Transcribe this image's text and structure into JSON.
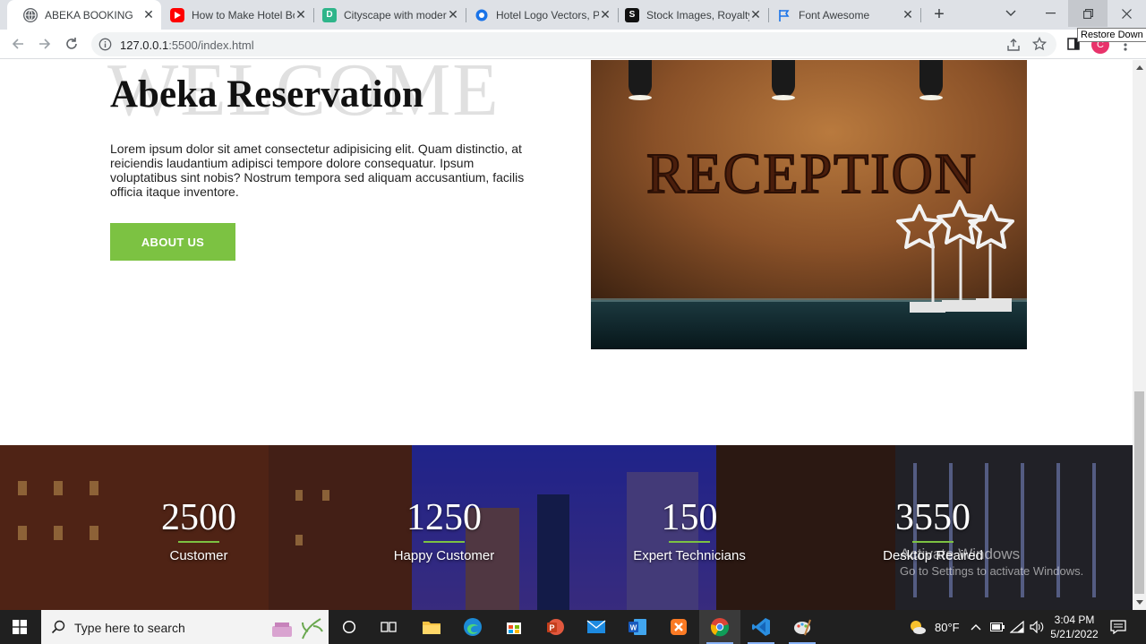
{
  "browser": {
    "tabs": [
      {
        "title": "ABEKA BOOKING",
        "icon": "globe-icon",
        "active": true
      },
      {
        "title": "How to Make Hotel Booking",
        "icon": "youtube-icon",
        "active": false
      },
      {
        "title": "Cityscape with modern",
        "icon": "depositphotos-icon",
        "active": false
      },
      {
        "title": "Hotel Logo Vectors, PNG",
        "icon": "vectors-icon",
        "active": false
      },
      {
        "title": "Stock Images, Royalty-Free",
        "icon": "shutterstock-icon",
        "active": false
      },
      {
        "title": "Font Awesome",
        "icon": "font-awesome-flag-icon",
        "active": false
      }
    ],
    "url_host": "127.0.0.1",
    "url_rest": ":5500/index.html",
    "tooltip": "Restore Down",
    "profile_initial": "C"
  },
  "page": {
    "bg_word": "WELCOME",
    "heading": "Abeka Reservation",
    "lead": "Lorem ipsum dolor sit amet consectetur adipisicing elit. Quam distinctio, at reiciendis laudantium adipisci tempore dolore consequatur. Ipsum voluptatibus sint nobis? Nostrum tempora sed aliquam accusantium, facilis officia itaque inventore.",
    "about_button": "ABOUT US",
    "photo_sign": "RECEPTION",
    "accent_color": "#7cc242",
    "stats": [
      {
        "number": "2500",
        "label": "Customer"
      },
      {
        "number": "1250",
        "label": "Happy Customer"
      },
      {
        "number": "150",
        "label": "Expert Technicians"
      },
      {
        "number": "3550",
        "label": "Desktop Reaired"
      }
    ],
    "watermark_title": "Activate Windows",
    "watermark_sub": "Go to Settings to activate Windows."
  },
  "taskbar": {
    "search_placeholder": "Type here to search",
    "weather": "80°F",
    "time": "3:04 PM",
    "date": "5/21/2022"
  }
}
